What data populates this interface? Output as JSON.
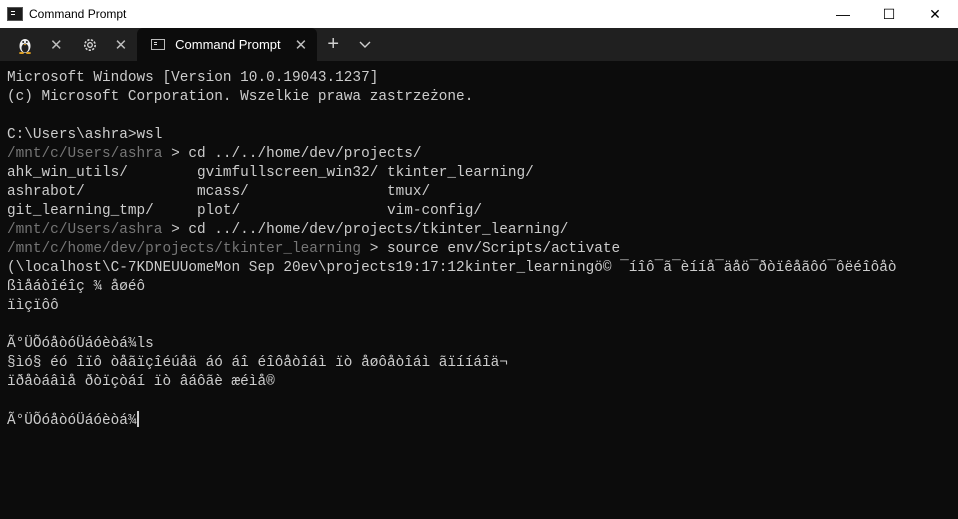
{
  "window": {
    "title": "Command Prompt"
  },
  "caption": {
    "minimize": "—",
    "maximize": "☐",
    "close": "✕"
  },
  "tabs": [
    {
      "icon": "linux-penguin-icon",
      "close": "✕"
    },
    {
      "icon": "gear-icon",
      "close": "✕"
    },
    {
      "label": "Command Prompt",
      "icon": "cmd-icon",
      "close": "✕",
      "active": true
    }
  ],
  "tabbar": {
    "new_tab": "+",
    "dropdown": "⌵"
  },
  "terminal": {
    "lines": [
      {
        "text": "Microsoft Windows [Version 10.0.19043.1237]"
      },
      {
        "text": "(c) Microsoft Corporation. Wszelkie prawa zastrzeżone."
      },
      {
        "text": ""
      },
      {
        "text": "C:\\Users\\ashra>wsl"
      },
      {
        "prompt": "/mnt/c/Users/ashra",
        "text": " > cd ../../home/dev/projects/"
      },
      {
        "text": "ahk_win_utils/        gvimfullscreen_win32/ tkinter_learning/"
      },
      {
        "text": "ashrabot/             mcass/                tmux/"
      },
      {
        "text": "git_learning_tmp/     plot/                 vim-config/"
      },
      {
        "prompt": "/mnt/c/Users/ashra",
        "text": " > cd ../../home/dev/projects/tkinter_learning/"
      },
      {
        "prompt": "/mnt/c/home/dev/projects/tkinter_learning",
        "text": " > source env/Scripts/activate"
      },
      {
        "text": "(\\localhost\\C-7KDNEUUomeMon Sep 20ev\\projects19:17:12kinter_learningö© ¯íîô¯ã¯èííå¯äåö¯ðòïêåãôó¯ôëéîôåò"
      },
      {
        "text": "ßìåáòîéîç ¾ åøéô"
      },
      {
        "text": "ïìçïôô"
      },
      {
        "text": ""
      },
      {
        "text": "Ã°ÜÕóåòóÜáóèòá¾ls"
      },
      {
        "text": "§ìó§ éó îïô òåãïçîéúåä áó áî éîôåòîáì ïò åøôåòîáì ãïííáîä¬"
      },
      {
        "text": "ïðåòáâìå ðòïçòáí ïò âáôãè æéìå®"
      },
      {
        "text": ""
      },
      {
        "text": "Ã°ÜÕóåòóÜáóèòá¾",
        "cursor": true
      }
    ]
  }
}
